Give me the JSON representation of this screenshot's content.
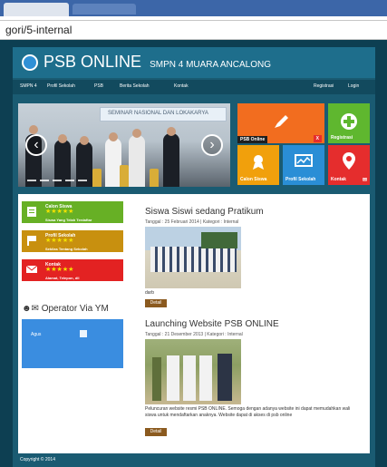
{
  "browser": {
    "url": "gori/5-internal"
  },
  "site": {
    "brand": "PSB ONLINE",
    "subtitle": "SMPN 4 MUARA ANCALONG",
    "nav": {
      "left": [
        "SMPN 4",
        "Profil Sekolah",
        "PSB",
        "Berita Sekolah",
        "Kontak"
      ],
      "right": [
        "Registrasi",
        "Login"
      ]
    },
    "banner": {
      "text": "SEMINAR NASIONAL DAN LOKAKARYA"
    },
    "slider": {
      "prev_label": "previous",
      "next_label": "next"
    },
    "tiles": [
      {
        "label": "PSB Online",
        "sub": "X",
        "color": "#f26d1f"
      },
      {
        "label": "Registrasi",
        "color": "#5fb72f"
      },
      {
        "label": "Calon Siswa",
        "color": "#f1a00c"
      },
      {
        "label": "Profil Sekolah",
        "color": "#2a8ed6"
      },
      {
        "label": "Kontak",
        "sub": "✉",
        "color": "#e52d2d"
      }
    ],
    "sidebar": {
      "boxes": [
        {
          "title": "Calon Siswa",
          "desc": "Siswa Yang Telah Terdaftar",
          "color": "#67b025"
        },
        {
          "title": "Profil Sekolah",
          "desc": "Sekilas Tentang Sekolah",
          "color": "#c8900f"
        },
        {
          "title": "Kontak",
          "desc": "Alamat, Telepon, dll",
          "color": "#e32222"
        }
      ],
      "stars": "★★★★★",
      "ym_title": "Operator Via YM",
      "ym_user": "Agus"
    },
    "posts": [
      {
        "title": "Siswa Siswi sedang Pratikum",
        "meta": "Tanggal : 25 Februari 2014 | Kategori : Internal",
        "excerpt": "darb",
        "button": "Detail"
      },
      {
        "title": "Launching Website PSB ONLINE",
        "meta": "Tanggal : 21 Desember 2013 | Kategori : Internal",
        "excerpt": "Peluncuran website resmi PSB ONLINE. Semoga dengan adanya website ini dapat memudahkan wali siswa untuk mendaftarkan anaknya. Website dapat di akses di psb online",
        "button": "Detail"
      }
    ],
    "footer": {
      "copyright": "Copyright © 2014"
    }
  }
}
